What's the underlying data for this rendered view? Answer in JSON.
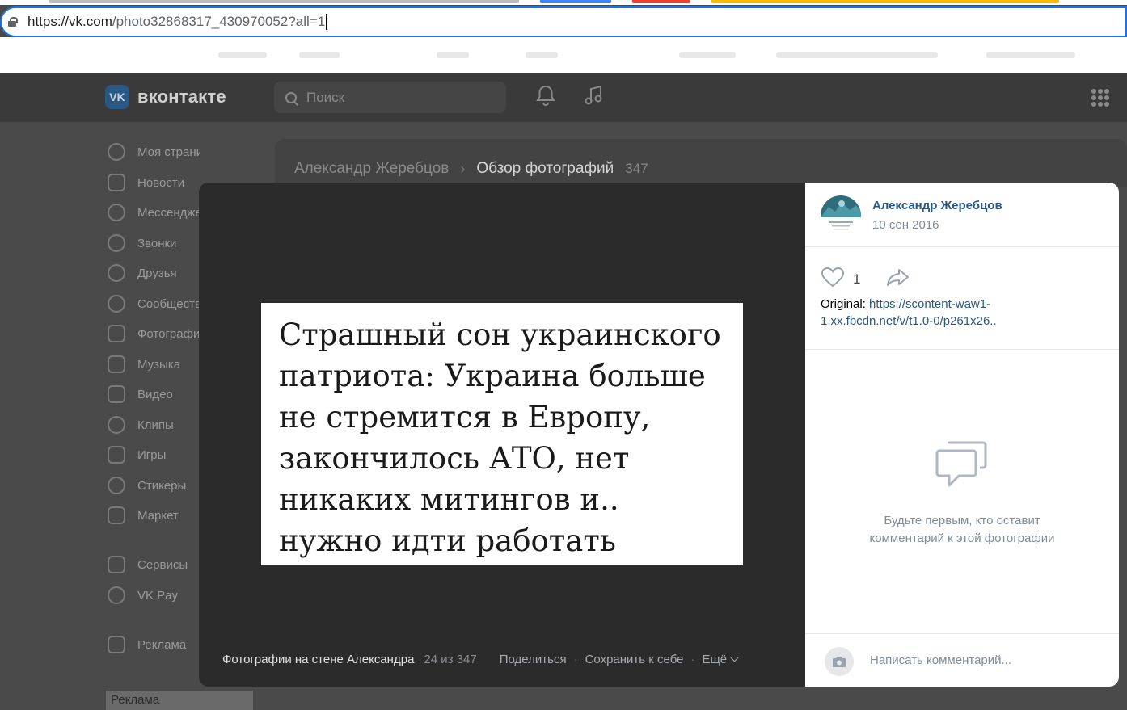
{
  "browser": {
    "url_host": "https://vk.com",
    "url_path": "/photo32868317_430970052?all=1"
  },
  "header": {
    "logo_text": "вконтакте",
    "logo_mark": "VK",
    "search_placeholder": "Поиск",
    "icons": [
      "bell-icon",
      "music-icon",
      "apps-grid-icon"
    ]
  },
  "nav": {
    "items": [
      {
        "label": "Моя страница",
        "icon": "user-icon"
      },
      {
        "label": "Новости",
        "icon": "news-icon"
      },
      {
        "label": "Мессенджер",
        "icon": "chat-icon"
      },
      {
        "label": "Звонки",
        "icon": "phone-icon"
      },
      {
        "label": "Друзья",
        "icon": "friends-icon"
      },
      {
        "label": "Сообщества",
        "icon": "groups-icon"
      },
      {
        "label": "Фотографии",
        "icon": "photo-icon"
      },
      {
        "label": "Музыка",
        "icon": "music-icon"
      },
      {
        "label": "Видео",
        "icon": "video-icon"
      },
      {
        "label": "Клипы",
        "icon": "clips-icon"
      },
      {
        "label": "Игры",
        "icon": "games-icon"
      },
      {
        "label": "Стикеры",
        "icon": "smile-icon"
      },
      {
        "label": "Маркет",
        "icon": "bag-icon"
      },
      {
        "label": "Сервисы",
        "icon": "services-icon"
      },
      {
        "label": "VK Pay",
        "icon": "ruble-icon"
      },
      {
        "label": "Реклама",
        "icon": "megaphone-icon"
      }
    ],
    "promo_label": "Реклама"
  },
  "breadcrumb": {
    "owner": "Александр Жеребцов",
    "current": "Обзор фотографий",
    "count": "347"
  },
  "photo": {
    "lines": [
      "Страшный сон украинского",
      "патриота: Украина больше",
      "не стремится в Европу,",
      "закончилось АТО, нет",
      "никаких митингов и..",
      "нужно идти работать"
    ]
  },
  "viewer_footer": {
    "album": "Фотографии на стене Александра",
    "position": "24 из 347",
    "share": "Поделиться",
    "save": "Сохранить к себе",
    "more": "Ещё"
  },
  "sidebar": {
    "author": "Александр Жеребцов",
    "date": "10 сен 2016",
    "likes": "1",
    "original_label": "Original:",
    "original_link": "https://scontent-waw1-1.xx.fbcdn.net/v/t1.0-0/p261x26..",
    "empty_line1": "Будьте первым, кто оставит",
    "empty_line2": "комментарий к этой фотографии",
    "comment_placeholder": "Написать комментарий..."
  },
  "colors": {
    "link": "#2a5885",
    "muted": "#818c99",
    "focus_border": "#1a73e8"
  }
}
